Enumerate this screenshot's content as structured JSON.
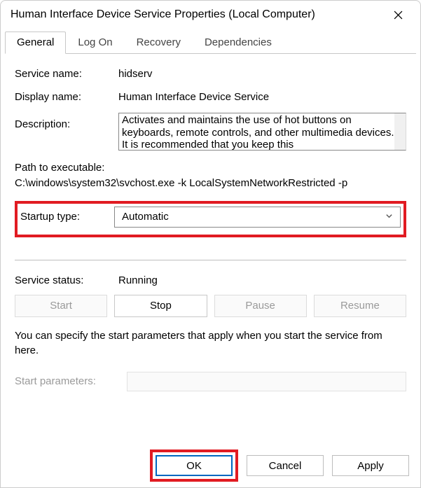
{
  "window": {
    "title": "Human Interface Device Service Properties (Local Computer)"
  },
  "tabs": [
    "General",
    "Log On",
    "Recovery",
    "Dependencies"
  ],
  "labels": {
    "service_name": "Service name:",
    "display_name": "Display name:",
    "description": "Description:",
    "path": "Path to executable:",
    "startup_type": "Startup type:",
    "service_status": "Service status:",
    "start_params": "Start parameters:"
  },
  "values": {
    "service_name": "hidserv",
    "display_name": "Human Interface Device Service",
    "description": "Activates and maintains the use of hot buttons on keyboards, remote controls, and other multimedia devices. It is recommended that you keep this",
    "path": "C:\\windows\\system32\\svchost.exe -k LocalSystemNetworkRestricted -p",
    "startup_type": "Automatic",
    "service_status": "Running"
  },
  "buttons": {
    "start": "Start",
    "stop": "Stop",
    "pause": "Pause",
    "resume": "Resume",
    "ok": "OK",
    "cancel": "Cancel",
    "apply": "Apply"
  },
  "hint": "You can specify the start parameters that apply when you start the service from here."
}
